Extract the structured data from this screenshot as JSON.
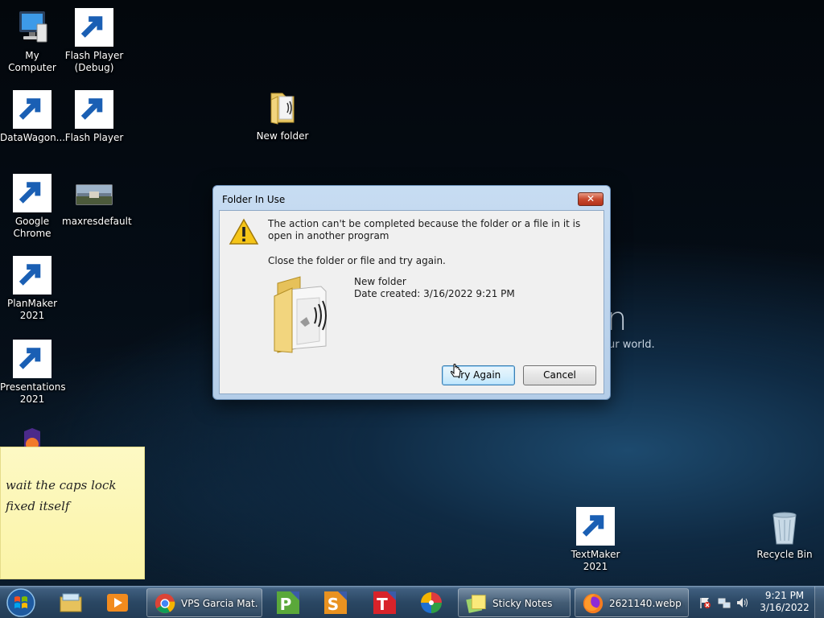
{
  "desktop": {
    "icons": [
      {
        "label": "My Computer"
      },
      {
        "label": "Flash Player (Debug)"
      },
      {
        "label": "DataWagon..."
      },
      {
        "label": "Flash Player"
      },
      {
        "label": "New folder"
      },
      {
        "label": "Google Chrome"
      },
      {
        "label": "maxresdefault"
      },
      {
        "label": "PlanMaker 2021"
      },
      {
        "label": "Presentations 2021"
      },
      {
        "label": "TextMaker 2021"
      },
      {
        "label": "Recycle Bin"
      }
    ],
    "wallpaper": {
      "big": "n",
      "small": "ur world."
    }
  },
  "dialog": {
    "title": "Folder In Use",
    "close_label": "✕",
    "message": "The action can't be completed because the folder or a file in it is open in another program",
    "instruction": "Close the folder or file and try again.",
    "item_name": "New folder",
    "item_date": "Date created: 3/16/2022 9:21 PM",
    "try_again_label": "Try Again",
    "cancel_label": "Cancel"
  },
  "sticky": {
    "text": "wait the caps lock\nfixed itself"
  },
  "taskbar": {
    "buttons": [
      {
        "label": "VPS Garcia Mat..."
      },
      {
        "label": "Sticky Notes"
      },
      {
        "label": "2621140.webp ..."
      }
    ],
    "clock_time": "9:21 PM",
    "clock_date": "3/16/2022"
  },
  "colors": {
    "dialog_frame": "#b4cde8",
    "sticky_bg": "#fbf4a7",
    "taskbar": "#2a4763"
  }
}
